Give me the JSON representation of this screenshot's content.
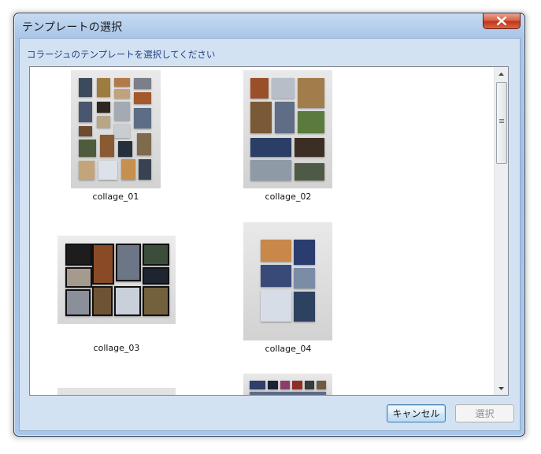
{
  "window": {
    "title": "テンプレートの選択",
    "close_icon": "close-icon"
  },
  "instruction": "コラージュのテンプレートを選択してください",
  "templates": [
    {
      "name": "collage_01"
    },
    {
      "name": "collage_02"
    },
    {
      "name": "collage_03"
    },
    {
      "name": "collage_04"
    }
  ],
  "buttons": {
    "cancel": "キャンセル",
    "select": "選択"
  },
  "colors": {
    "title_bar": "#a9c6e8",
    "client_bg": "#d3e2f3",
    "instruction_text": "#1f3f80",
    "close_button": "#c23418"
  }
}
